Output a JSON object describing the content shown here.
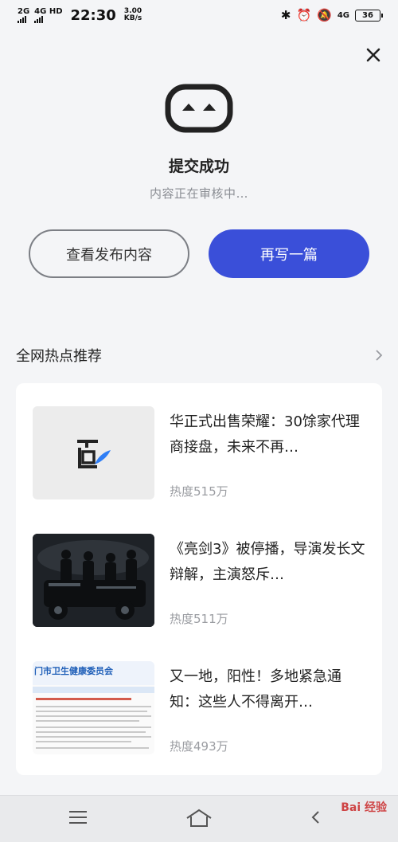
{
  "status_bar": {
    "net1": "2G",
    "net2": "4G HD",
    "time": "22:30",
    "speed_value": "3.00",
    "speed_unit": "KB/s",
    "net3": "4G",
    "battery": "36"
  },
  "result": {
    "title": "提交成功",
    "subtitle": "内容正在审核中…"
  },
  "actions": {
    "view_label": "查看发布内容",
    "write_again_label": "再写一篇"
  },
  "hot": {
    "title": "全网热点推荐",
    "items": [
      {
        "title": "华正式出售荣耀：30馀家代理商接盘，未来不再…",
        "heat": "热度515万"
      },
      {
        "title": "《亮剑3》被停播，导演发长文辩解，主演怒斥…",
        "heat": "热度511万"
      },
      {
        "title": "又一地，阳性！多地紧急通知：这些人不得离开…",
        "heat": "热度493万"
      }
    ]
  },
  "thumbs": {
    "doc_header": "门市卫生健康委员会"
  },
  "watermark": "Bai 经验",
  "colors": {
    "primary": "#3a4fd9",
    "background": "#f4f5f7",
    "muted_text": "#9a9ca1"
  }
}
